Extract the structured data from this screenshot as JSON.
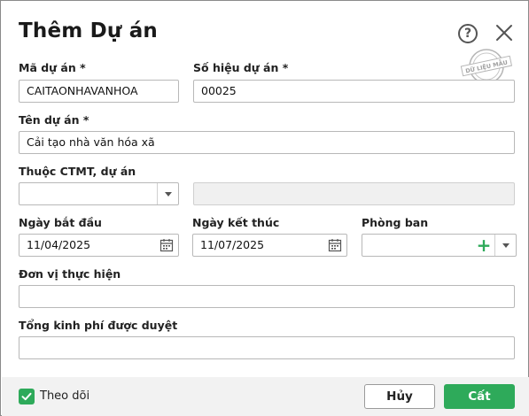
{
  "dialog": {
    "title": "Thêm Dự án",
    "help_icon_glyph": "?",
    "stamp_text": "DỮ LIỆU MẪU"
  },
  "fields": {
    "project_code": {
      "label": "Mã dự án *",
      "value": "CAITAONHAVANHOA"
    },
    "project_number": {
      "label": "Số hiệu dự án *",
      "value": "00025"
    },
    "project_name": {
      "label": "Tên dự án *",
      "value": "Cải tạo nhà văn hóa xã"
    },
    "program": {
      "label": "Thuộc CTMT, dự án",
      "value": "",
      "secondary_value": ""
    },
    "start_date": {
      "label": "Ngày bắt đầu",
      "value": "11/04/2025"
    },
    "end_date": {
      "label": "Ngày kết thúc",
      "value": "11/07/2025"
    },
    "department": {
      "label": "Phòng ban",
      "value": "",
      "add_glyph": "+"
    },
    "implementing_unit": {
      "label": "Đơn vị thực hiện",
      "value": ""
    },
    "approved_budget": {
      "label": "Tổng kinh phí được duyệt",
      "value": ""
    }
  },
  "footer": {
    "follow_label": "Theo dõi",
    "follow_checked": true,
    "cancel_label": "Hủy",
    "save_label": "Cất"
  },
  "colors": {
    "accent": "#2eaa5a"
  }
}
